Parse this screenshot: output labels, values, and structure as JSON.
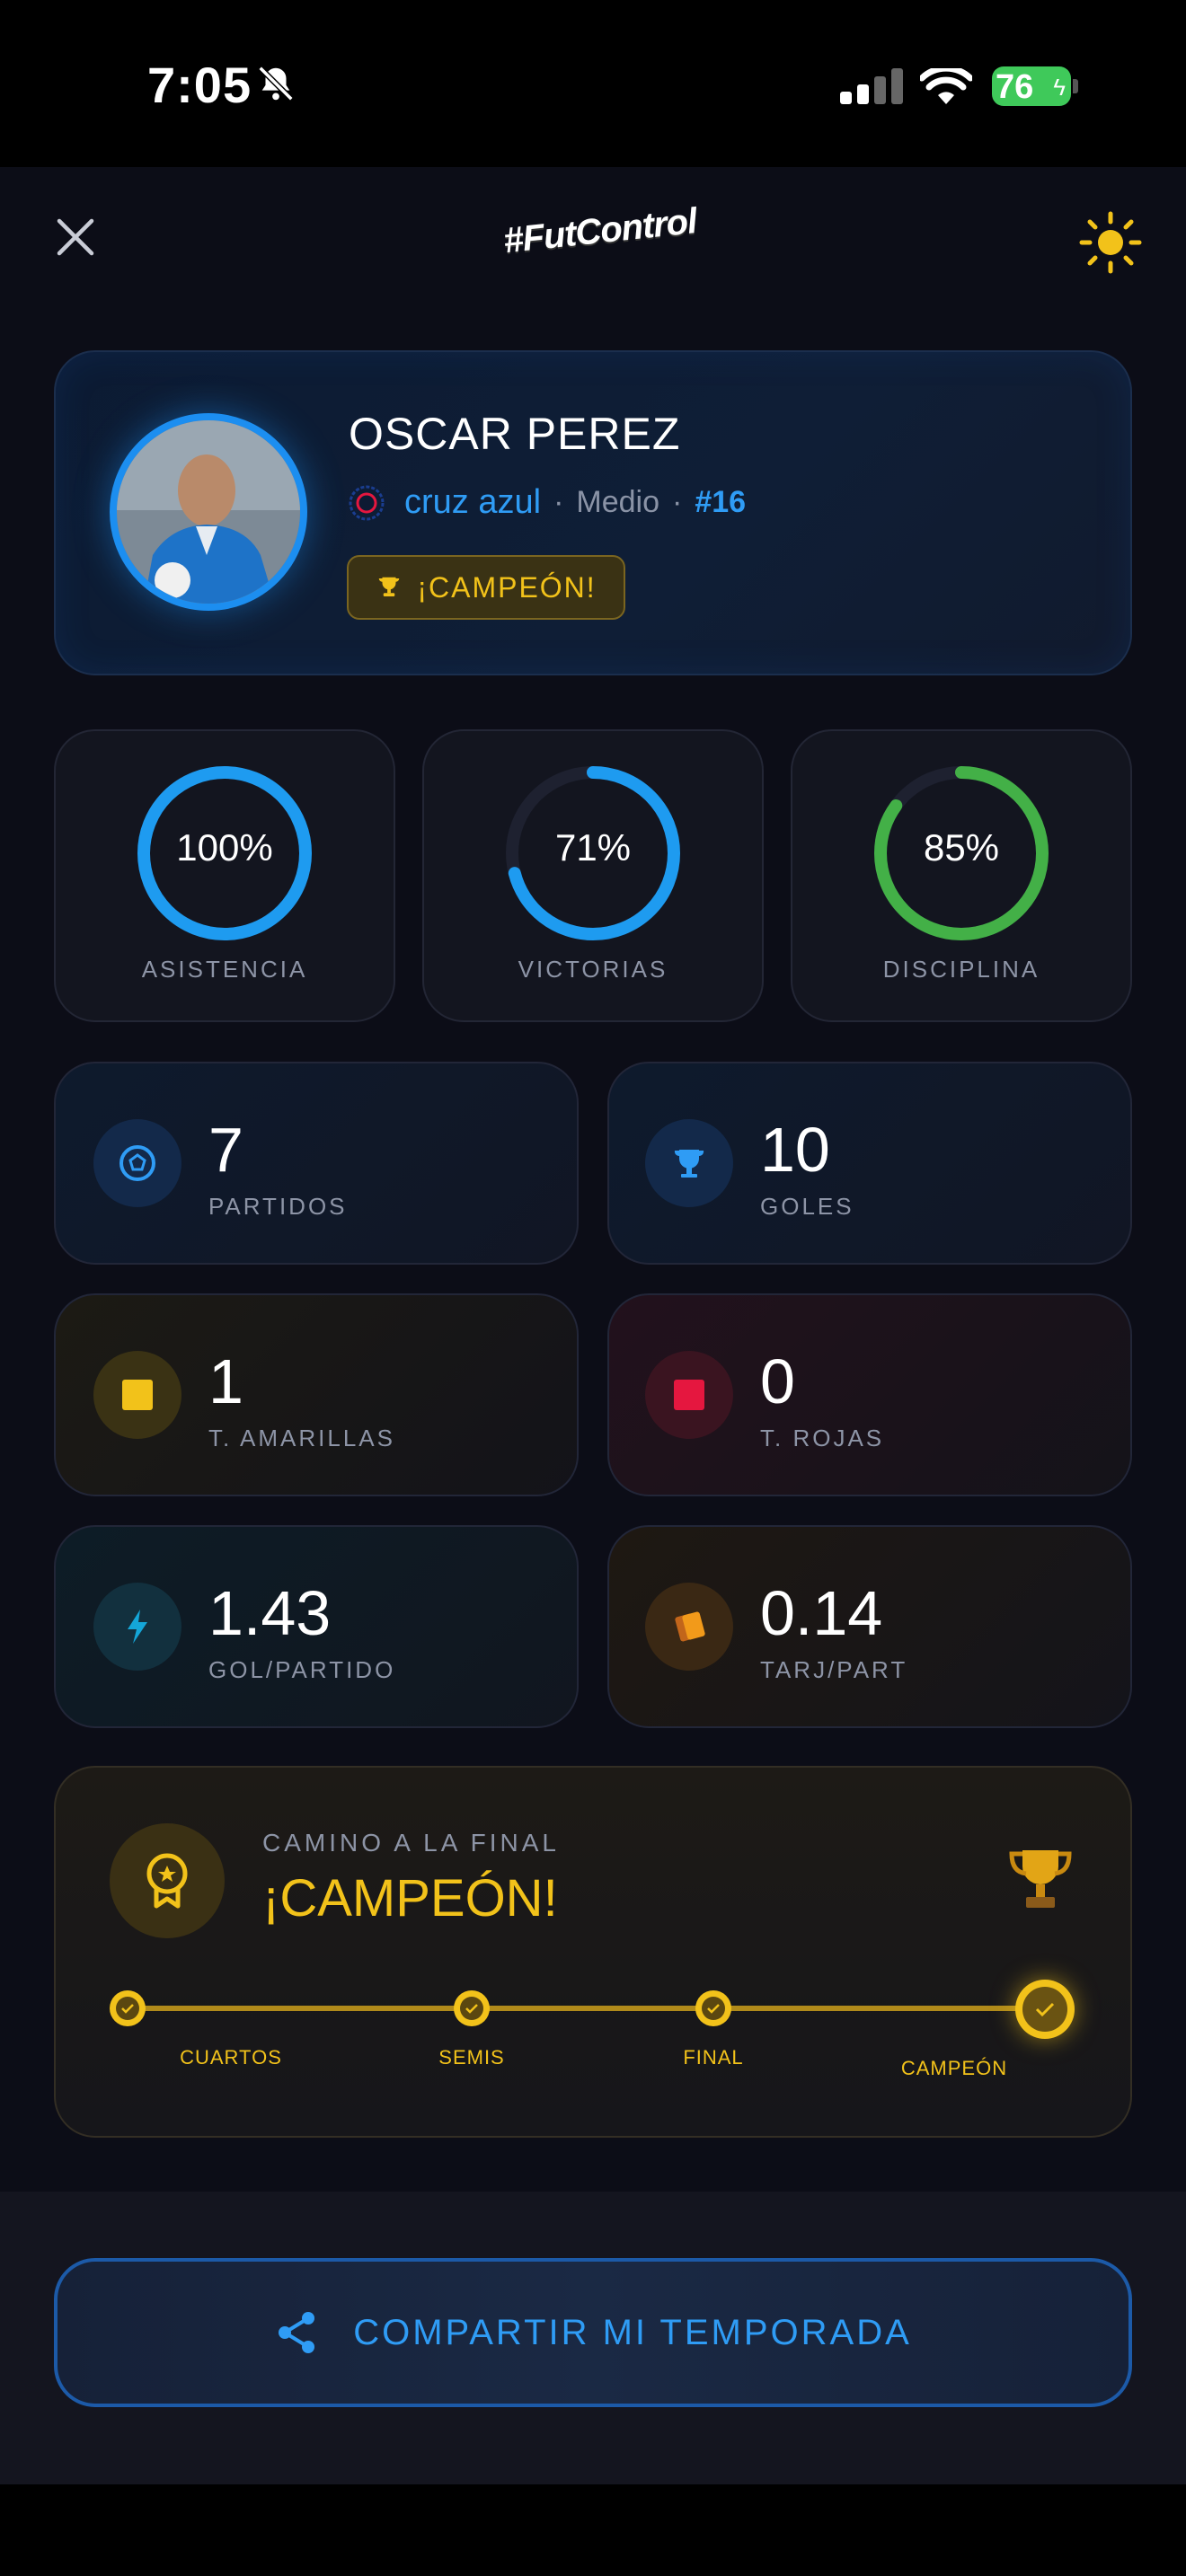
{
  "status_bar": {
    "time": "7:05",
    "battery": "76"
  },
  "header": {
    "brand": "#FutControl"
  },
  "profile": {
    "name": "OSCAR PEREZ",
    "club": "cruz azul",
    "separator": "·",
    "position": "Medio",
    "number": "#16",
    "badge": "¡CAMPEÓN!"
  },
  "rings": [
    {
      "value": "100%",
      "label": "ASISTENCIA",
      "percent": 100,
      "color": "#1e9bf0"
    },
    {
      "value": "71%",
      "label": "VICTORIAS",
      "percent": 71,
      "color": "#1e9bf0"
    },
    {
      "value": "85%",
      "label": "DISCIPLINA",
      "percent": 85,
      "color": "#43b047"
    }
  ],
  "stats": [
    {
      "value": "7",
      "label": "PARTIDOS",
      "icon": "soccer-ball-icon"
    },
    {
      "value": "10",
      "label": "GOLES",
      "icon": "trophy-icon"
    },
    {
      "value": "1",
      "label": "T. AMARILLAS",
      "icon": "yellow-card-icon"
    },
    {
      "value": "0",
      "label": "T. ROJAS",
      "icon": "red-card-icon"
    },
    {
      "value": "1.43",
      "label": "GOL/PARTIDO",
      "icon": "bolt-icon"
    },
    {
      "value": "0.14",
      "label": "TARJ/PART",
      "icon": "cards-icon"
    }
  ],
  "road": {
    "caption": "CAMINO A LA FINAL",
    "title": "¡CAMPEÓN!",
    "steps": [
      "CUARTOS",
      "SEMIS",
      "FINAL",
      "CAMPEÓN"
    ]
  },
  "share": {
    "label": "COMPARTIR MI TEMPORADA"
  },
  "colors": {
    "accent_blue": "#2f9cf5",
    "gold": "#f2c21a",
    "green": "#43b047",
    "red": "#e5173f"
  }
}
